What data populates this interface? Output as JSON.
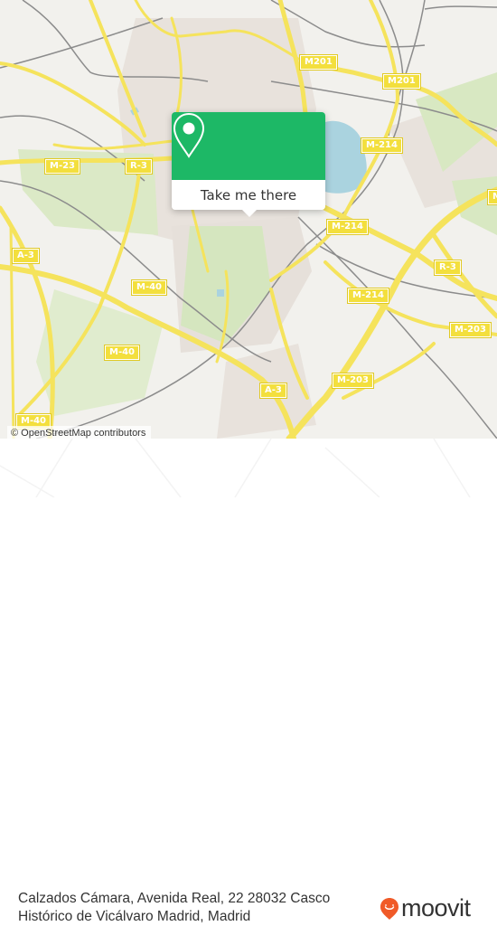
{
  "map": {
    "attribution": "© OpenStreetMap contributors",
    "road_labels": [
      {
        "id": "m201-a",
        "text": "M201"
      },
      {
        "id": "m201-b",
        "text": "M201"
      },
      {
        "id": "m214-a",
        "text": "M-214"
      },
      {
        "id": "m214-b",
        "text": "M-214"
      },
      {
        "id": "m214-c",
        "text": "M-214"
      },
      {
        "id": "m23",
        "text": "M-23"
      },
      {
        "id": "r3-a",
        "text": "R-3"
      },
      {
        "id": "r3-b",
        "text": "R-3"
      },
      {
        "id": "a3-a",
        "text": "A-3"
      },
      {
        "id": "a3-b",
        "text": "A-3"
      },
      {
        "id": "m40-a",
        "text": "M-40"
      },
      {
        "id": "m40-b",
        "text": "M-40"
      },
      {
        "id": "m40-c",
        "text": "M-40"
      },
      {
        "id": "m203-a",
        "text": "M-203"
      },
      {
        "id": "m203-b",
        "text": "M-203"
      },
      {
        "id": "m-partial",
        "text": "M"
      }
    ],
    "colors": {
      "background": "#f2f1ed",
      "road": "#f5e35c",
      "water": "#aad3df",
      "park": "#d8e8c2",
      "urban": "#e6e0dc",
      "rail": "#8c8c8c"
    }
  },
  "popup": {
    "icon": "map-pin-icon",
    "button_label": "Take me there",
    "accent_color": "#1db866"
  },
  "footer": {
    "address": "Calzados Cámara, Avenida Real, 22 28032 Casco Histórico de Vicálvaro Madrid, Madrid",
    "brand": "moovit",
    "brand_icon": "moovit-pin-icon",
    "brand_color": "#f05a28"
  }
}
